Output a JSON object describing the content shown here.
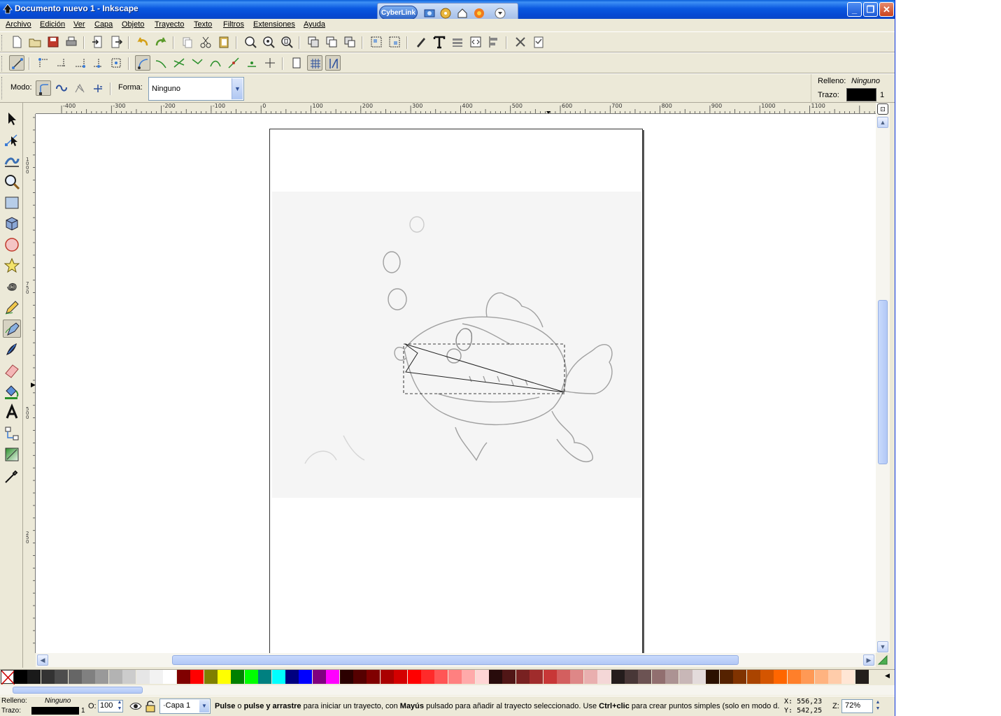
{
  "window": {
    "title": "Documento nuevo 1 - Inkscape",
    "cyberlink_label": "CyberLink",
    "buttons": {
      "minimize": "_",
      "restore": "❐",
      "close": "✕"
    }
  },
  "menu": [
    "Archivo",
    "Edición",
    "Ver",
    "Capa",
    "Objeto",
    "Trayecto",
    "Texto",
    "Filtros",
    "Extensiones",
    "Ayuda"
  ],
  "tool_controls": {
    "mode_label": "Modo:",
    "shape_label": "Forma:",
    "shape_value": "Ninguno"
  },
  "style_indicator": {
    "fill_label": "Relleno:",
    "fill_value": "Ninguno",
    "stroke_label": "Trazo:",
    "stroke_width": "1"
  },
  "rulers": {
    "horizontal": [
      "-400",
      "-300",
      "-200",
      "-100",
      "0",
      "100",
      "200",
      "300",
      "400",
      "500",
      "600",
      "700",
      "800",
      "900",
      "1000",
      "1100"
    ],
    "vertical": [
      "1000",
      "750",
      "500",
      "250"
    ]
  },
  "status": {
    "fill_label": "Relleno:",
    "fill_value": "Ninguno",
    "stroke_label": "Trazo:",
    "stroke_width": "1",
    "opacity_label": "O:",
    "opacity_value": "100",
    "layer": "·Capa 1",
    "message_b1": "Pulse",
    "message_t1": " o ",
    "message_b2": "pulse y arrastre",
    "message_t2": " para iniciar un trayecto, con ",
    "message_b3": "Mayús",
    "message_t3": " pulsado para añadir al trayecto seleccionado. Use ",
    "message_b4": "Ctrl+clic",
    "message_t4": " para crear puntos simples (solo en modo d.",
    "x_label": "X:",
    "x_value": "556,23",
    "y_label": "Y:",
    "y_value": "542,25",
    "zoom_label": "Z:",
    "zoom_value": "72%"
  },
  "palette": {
    "colors": [
      "#000000",
      "#1a1a1a",
      "#333333",
      "#4d4d4d",
      "#666666",
      "#808080",
      "#999999",
      "#b3b3b3",
      "#cccccc",
      "#e6e6e6",
      "#f2f2f2",
      "#ffffff",
      "#800000",
      "#ff0000",
      "#808000",
      "#ffff00",
      "#008000",
      "#00ff00",
      "#008080",
      "#00ffff",
      "#000080",
      "#0000ff",
      "#800080",
      "#ff00ff",
      "#2b0000",
      "#550000",
      "#800000",
      "#aa0000",
      "#d40000",
      "#ff0000",
      "#ff2a2a",
      "#ff5555",
      "#ff8080",
      "#ffaaaa",
      "#ffd5d5",
      "#280b0b",
      "#501616",
      "#782121",
      "#a02c2c",
      "#c83737",
      "#d35f5f",
      "#de8787",
      "#e9afaf",
      "#f4d7d7",
      "#241c1c",
      "#483737",
      "#6c5353",
      "#916f6f",
      "#ac9393",
      "#c8b7b7",
      "#e3dbdb",
      "#2b1100",
      "#552200",
      "#803300",
      "#aa4400",
      "#d45500",
      "#ff6600",
      "#ff7f2a",
      "#ff9955",
      "#ffb380",
      "#ffccaa",
      "#ffe6d5",
      "#241f1c"
    ]
  },
  "icons": {
    "toolbox": [
      "selector-arrow-icon",
      "node-editor-icon",
      "tweak-icon",
      "zoom-icon",
      "rectangle-icon",
      "box-3d-icon",
      "ellipse-icon",
      "star-icon",
      "spiral-icon",
      "pencil-icon",
      "pen-bezier-icon",
      "calligraphy-icon",
      "eraser-icon",
      "paint-bucket-icon",
      "text-icon",
      "connector-icon",
      "gradient-icon",
      "dropper-icon"
    ]
  }
}
